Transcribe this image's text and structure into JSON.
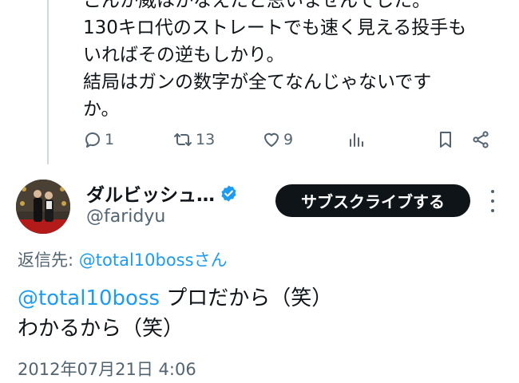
{
  "previous_tweet": {
    "lines": [
      "こんか威はかなえたと思いませんでした。",
      "130キロ代のストレートでも速く見える投手も",
      "いればその逆もしかり。",
      "結局はガンの数字が全てなんじゃないです",
      "か。"
    ],
    "actions": {
      "reply_count": "1",
      "retweet_count": "13",
      "like_count": "9"
    }
  },
  "tweet": {
    "display_name": "ダルビッシュ…",
    "handle": "@faridyu",
    "verified": true,
    "subscribe_label": "サブスクライブする",
    "reply_to_prefix": "返信先: ",
    "reply_to_user": "@total10bossさん",
    "body_mention": "@total10boss",
    "body_line1_rest": " プロだから（笑）",
    "body_line2": "わかるから（笑）",
    "timestamp": "2012年07月21日 4:06"
  },
  "colors": {
    "link": "#1d9bf0",
    "secondary_text": "#536471",
    "primary_text": "#0f1419",
    "button_bg": "#0f1419",
    "thread_line": "#cfd9de"
  },
  "icons": [
    "reply-icon",
    "retweet-icon",
    "like-icon",
    "views-icon",
    "bookmark-icon",
    "share-icon",
    "verified-badge-icon",
    "more-icon"
  ]
}
